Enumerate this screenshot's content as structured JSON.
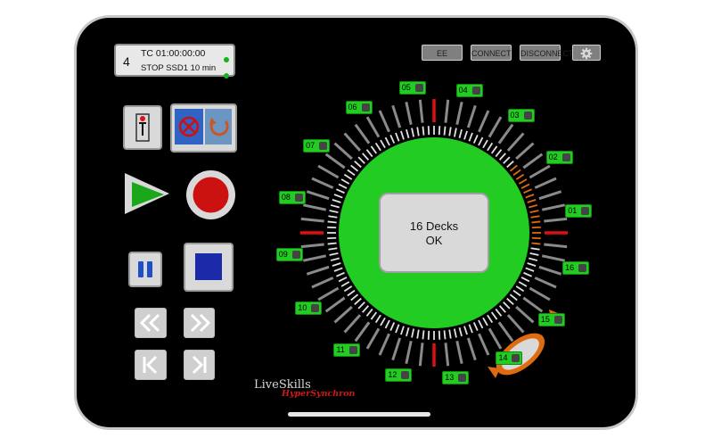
{
  "status": {
    "deck_number": "4",
    "timecode": "TC 01:00:00:00",
    "line2": "STOP  SSD1  10 min"
  },
  "toolbar": {
    "ee_label": "EE",
    "connect_label": "CONNECT",
    "disconnect_label": "DISCONNECT"
  },
  "icons": {
    "settings": "gear-icon",
    "loop": "loop-icon",
    "play": "play-icon",
    "record": "record-icon",
    "pause": "pause-icon",
    "stop": "stop-icon",
    "rewind": "rewind-icon",
    "fast_forward": "fast-forward-icon",
    "previous": "skip-previous-icon",
    "next": "skip-next-icon",
    "jog": "jog-dial-icon"
  },
  "decks": [
    "01",
    "02",
    "03",
    "04",
    "05",
    "06",
    "07",
    "08",
    "09",
    "10",
    "11",
    "12",
    "13",
    "14",
    "15",
    "16"
  ],
  "center": {
    "line1": "16 Decks",
    "line2": "OK"
  },
  "logo": {
    "main": "LiveSkills",
    "sub": "HyperSynchron"
  },
  "colors": {
    "accent_green": "#22cc22",
    "record_red": "#cc1111",
    "stop_blue": "#1a2aa8",
    "play_green": "#1aa81a",
    "jog_orange": "#e06a10"
  }
}
